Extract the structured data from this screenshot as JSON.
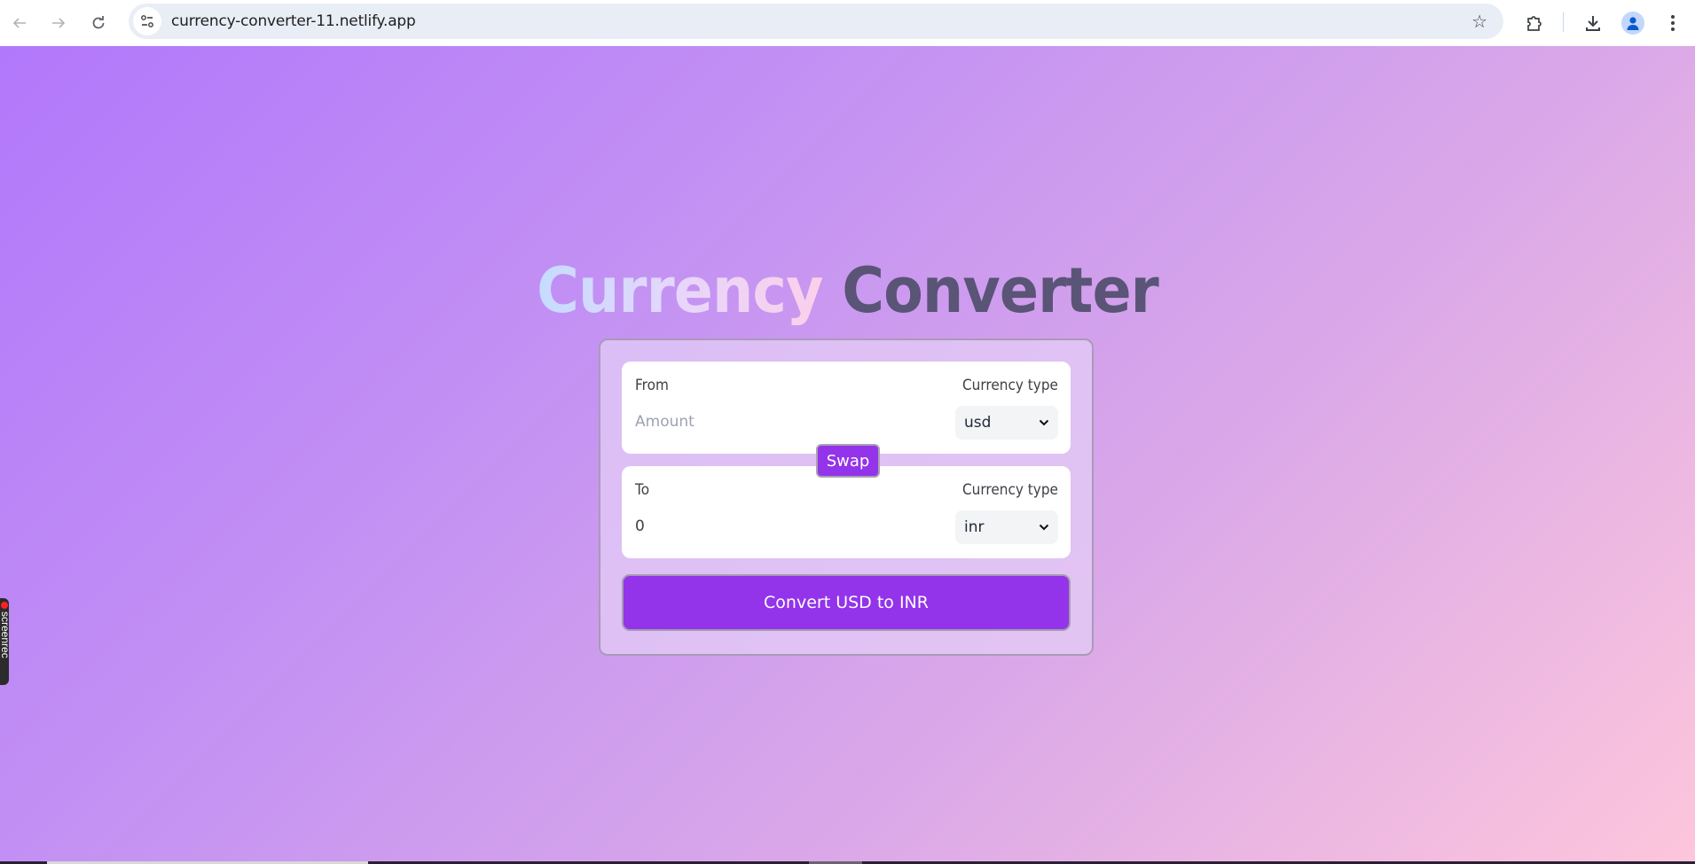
{
  "browser": {
    "url": "currency-converter-11.netlify.app",
    "icons": {
      "back": "arrow-left",
      "forward": "arrow-right",
      "reload": "reload",
      "site_info": "tune",
      "bookmark": "star-outline",
      "extensions": "puzzle-piece",
      "downloads": "download-arrow",
      "profile": "person-avatar",
      "menu": "vertical-dots"
    }
  },
  "app": {
    "title_part1": "Currency",
    "title_part2": "Converter",
    "from": {
      "label": "From",
      "currency_type_label": "Currency type",
      "amount_value": "",
      "amount_placeholder": "Amount",
      "currency": "usd"
    },
    "swap_label": "Swap",
    "to": {
      "label": "To",
      "currency_type_label": "Currency type",
      "amount_value": "0",
      "currency": "inr"
    },
    "convert_label": "Convert USD to INR",
    "colors": {
      "accent": "#9333ea",
      "title_dark": "#5a5476",
      "bg_start": "#b277fb",
      "bg_end": "#fdc6dc"
    }
  },
  "overlay": {
    "recorder_label": "screenrec"
  }
}
